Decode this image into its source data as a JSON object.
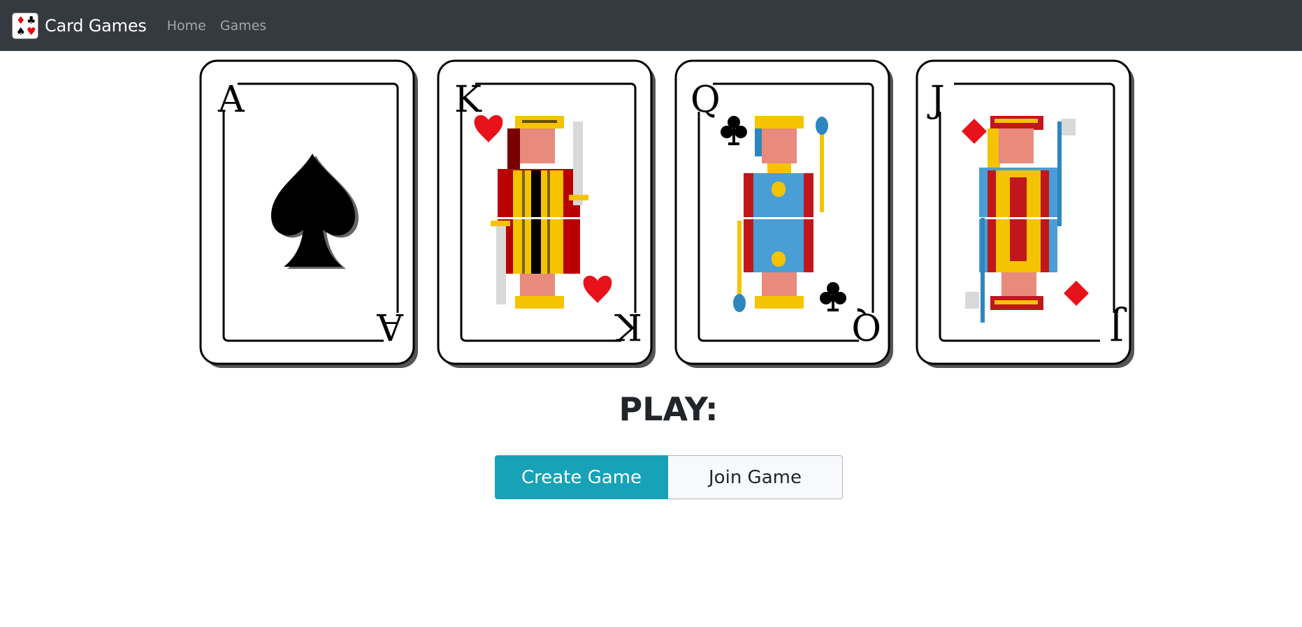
{
  "navbar": {
    "brand": "Card Games",
    "logo_icon": "card-suits-icon",
    "links": [
      "Home",
      "Games"
    ]
  },
  "cards": [
    {
      "rank": "A",
      "suit": "spades"
    },
    {
      "rank": "K",
      "suit": "hearts"
    },
    {
      "rank": "Q",
      "suit": "clubs"
    },
    {
      "rank": "J",
      "suit": "diamonds"
    }
  ],
  "play": {
    "title": "PLAY:",
    "create_label": "Create Game",
    "join_label": "Join Game"
  },
  "colors": {
    "navbar_bg": "#343a40",
    "create_button": "#17a2b8",
    "join_button": "#f8f9fa",
    "heart": "#e8121b",
    "gold": "#f5c400",
    "blue": "#2e86c1"
  }
}
